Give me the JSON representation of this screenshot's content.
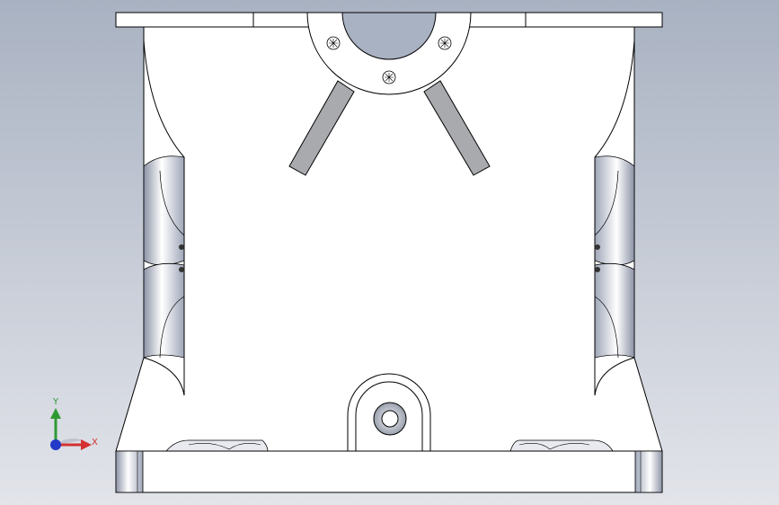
{
  "view": {
    "background_top": "#a9b2c2",
    "background_bottom": "#e2e4ea",
    "model_fill": "#ffffff",
    "edge_color": "#000000",
    "slot_fill": "#a8aaae",
    "shading_color": "#9ea6b8"
  },
  "model": {
    "parts": [
      "top-flange",
      "housing-body",
      "bearing-seat",
      "left-arm",
      "right-arm",
      "left-side-recess",
      "right-side-recess",
      "lower-lug",
      "base-plate"
    ]
  },
  "triad": {
    "x_label": "X",
    "y_label": "Y",
    "x_color": "#d43030",
    "y_color": "#2f9a34",
    "z_color": "#2339c8"
  }
}
